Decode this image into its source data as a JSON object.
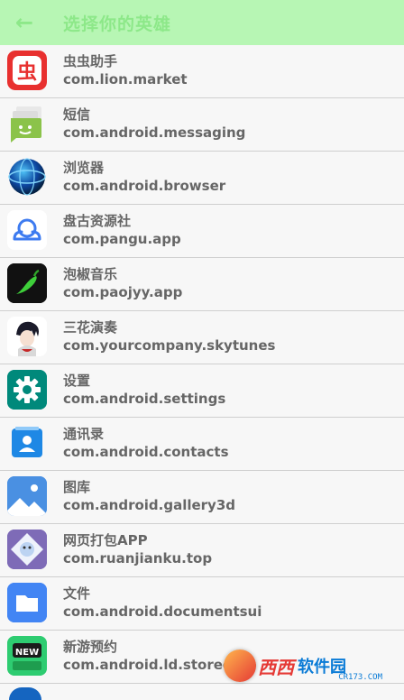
{
  "header": {
    "back_icon": "arrow-left-icon",
    "title": "选择你的英雄",
    "background": "#b7f6b4",
    "accent": "#8de889"
  },
  "apps": [
    {
      "name": "虫虫助手",
      "package": "com.lion.market",
      "icon": "chongchong-icon"
    },
    {
      "name": "短信",
      "package": "com.android.messaging",
      "icon": "messaging-icon"
    },
    {
      "name": "浏览器",
      "package": "com.android.browser",
      "icon": "browser-icon"
    },
    {
      "name": "盘古资源社",
      "package": "com.pangu.app",
      "icon": "pangu-icon"
    },
    {
      "name": "泡椒音乐",
      "package": "com.paojyy.app",
      "icon": "paojiao-icon"
    },
    {
      "name": "三花演奏",
      "package": "com.yourcompany.skytunes",
      "icon": "sanhua-icon"
    },
    {
      "name": "设置",
      "package": "com.android.settings",
      "icon": "settings-gear-icon"
    },
    {
      "name": "通讯录",
      "package": "com.android.contacts",
      "icon": "contacts-icon"
    },
    {
      "name": "图库",
      "package": "com.android.gallery3d",
      "icon": "gallery-icon"
    },
    {
      "name": "网页打包APP",
      "package": "com.ruanjianku.top",
      "icon": "webpack-app-icon"
    },
    {
      "name": "文件",
      "package": "com.android.documentsui",
      "icon": "files-folder-icon"
    },
    {
      "name": "新游预约",
      "package": "com.android.ld.storeeato",
      "icon": "new-game-icon"
    }
  ],
  "watermark": {
    "text_a": "西西",
    "text_b": "软件园",
    "sub": "CR173.COM"
  }
}
